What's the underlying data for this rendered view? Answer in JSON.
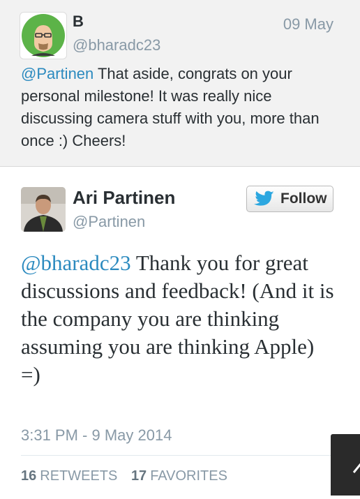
{
  "reply": {
    "name": "B",
    "handle": "@bharadc23",
    "date": "09 May",
    "mention": "@Partinen",
    "text": " That aside, congrats on your personal milestone! It was really nice discussing camera stuff with you, more than once :) Cheers!"
  },
  "tweet": {
    "name": "Ari Partinen",
    "handle": "@Partinen",
    "follow_label": "Follow",
    "mention": "@bharadc23",
    "text": " Thank you for great discussions and feedback! (And it is the company you are thinking assuming you are thinking Apple) =)",
    "timestamp": "3:31 PM - 9 May 2014",
    "retweets_count": "16",
    "retweets_label": "RETWEETS",
    "favorites_count": "17",
    "favorites_label": "FAVORITES"
  },
  "colors": {
    "link": "#2b8abf",
    "muted": "#8899a6",
    "twitter_blue": "#2ca7e0"
  }
}
